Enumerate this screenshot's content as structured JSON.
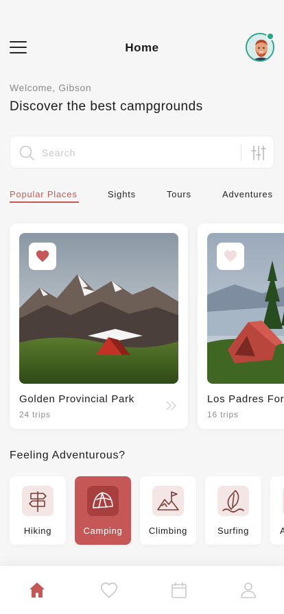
{
  "header": {
    "title": "Home",
    "menu_icon": "hamburger-menu-icon",
    "avatar_icon": "user-avatar"
  },
  "welcome": "Welcome, Gibson",
  "headline": "Discover the best campgrounds",
  "search": {
    "placeholder": "Search",
    "value": "",
    "filter_icon": "sliders-filter-icon"
  },
  "tabs": [
    {
      "label": "Popular Places",
      "active": true
    },
    {
      "label": "Sights",
      "active": false
    },
    {
      "label": "Tours",
      "active": false
    },
    {
      "label": "Adventures",
      "active": false
    }
  ],
  "places": [
    {
      "title": "Golden Provincial Park",
      "trips": "24 trips",
      "favorite": true
    },
    {
      "title": "Los Padres For",
      "trips": "16 trips",
      "favorite": false
    }
  ],
  "section_title": "Feeling Adventurous?",
  "categories": [
    {
      "label": "Hiking",
      "icon": "signpost-icon",
      "active": false
    },
    {
      "label": "Camping",
      "icon": "tent-icon",
      "active": true
    },
    {
      "label": "Climbing",
      "icon": "mountain-flag-icon",
      "active": false
    },
    {
      "label": "Surfing",
      "icon": "surfboard-icon",
      "active": false
    },
    {
      "label": "A",
      "icon": "activity-icon",
      "active": false
    }
  ],
  "bottom_nav": [
    {
      "icon": "home-icon",
      "active": true
    },
    {
      "icon": "heart-icon",
      "active": false
    },
    {
      "icon": "calendar-icon",
      "active": false
    },
    {
      "icon": "profile-icon",
      "active": false
    }
  ],
  "colors": {
    "accent": "#c55757",
    "accent_light": "#f3e6e4",
    "avatar_ring": "#2aa58b",
    "background": "#f6f6f6"
  }
}
